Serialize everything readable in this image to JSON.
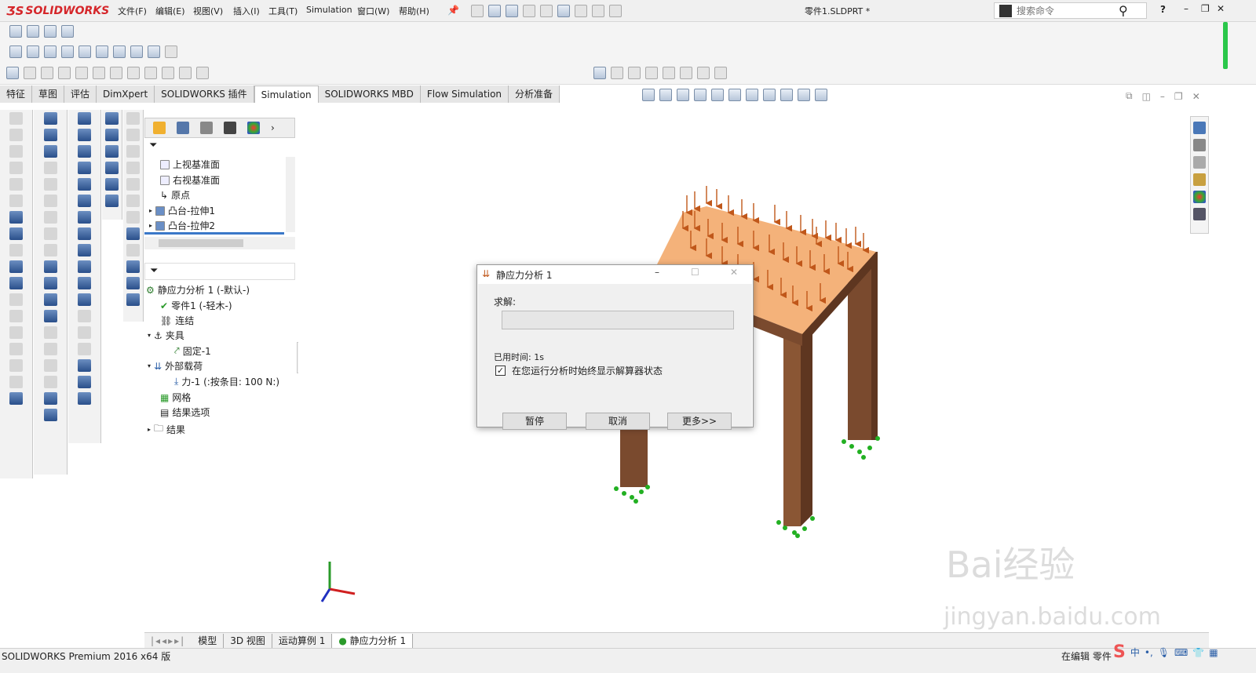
{
  "app": {
    "logo_text": "SOLIDWORKS",
    "doc_title": "零件1.SLDPRT *",
    "search_placeholder": "搜索命令",
    "help_label": "?"
  },
  "menu": [
    "文件(F)",
    "编辑(E)",
    "视图(V)",
    "插入(I)",
    "工具(T)",
    "Simulation",
    "窗口(W)",
    "帮助(H)"
  ],
  "tabs": [
    "特征",
    "草图",
    "评估",
    "DimXpert",
    "SOLIDWORKS 插件",
    "Simulation",
    "SOLIDWORKS MBD",
    "Flow Simulation",
    "分析准备"
  ],
  "active_tab": "Simulation",
  "feature_tree": {
    "items": [
      "上视基准面",
      "右视基准面",
      "原点",
      "凸台-拉伸1",
      "凸台-拉伸2"
    ]
  },
  "sim_tree": {
    "study": "静应力分析 1 (-默认-)",
    "part": "零件1 (-轻木-)",
    "connections": "连结",
    "fixtures": "夹具",
    "fixture_1": "固定-1",
    "loads": "外部载荷",
    "force_1": "力-1 (:按条目: 100 N:)",
    "mesh": "网格",
    "result_options": "结果选项",
    "results": "结果"
  },
  "dialog": {
    "title": "静应力分析 1",
    "solve_label": "求解:",
    "elapsed": "已用时间: 1s",
    "checkbox_label": "在您运行分析时始终显示解算器状态",
    "checkbox_checked": true,
    "progress": 0,
    "btn_pause": "暂停",
    "btn_cancel": "取消",
    "btn_more": "更多>>"
  },
  "bottom_tabs": [
    "模型",
    "3D 视图",
    "运动算例 1",
    "静应力分析 1"
  ],
  "status": {
    "left": "SOLIDWORKS Premium 2016 x64 版",
    "right": "在编辑 零件"
  },
  "watermark": {
    "text": "Bai经验",
    "url": "jingyan.baidu.com"
  },
  "colors": {
    "top_face": "#f4b27a",
    "legs": "#7a4a2e",
    "arrow": "#c0571a",
    "fixture": "#22b022",
    "brand": "#d5262a"
  }
}
